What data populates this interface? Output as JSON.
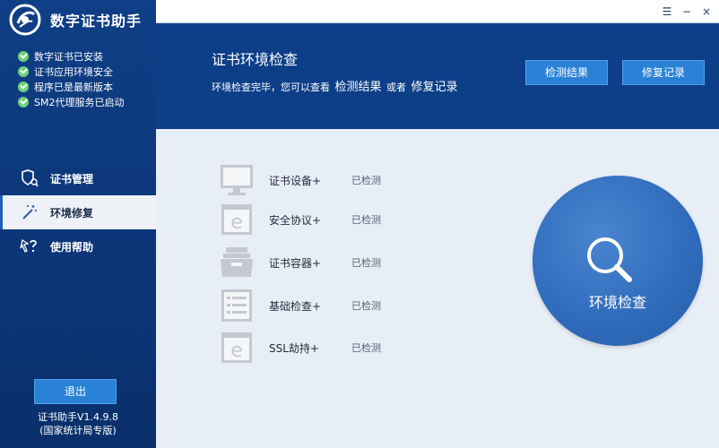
{
  "app": {
    "title": "数字证书助手"
  },
  "status_list": [
    "数字证书已安装",
    "证书应用环境安全",
    "程序已是最新版本",
    "SM2代理服务已启动"
  ],
  "nav": [
    {
      "label": "证书管理",
      "icon": "certificate-shield-icon",
      "active": false
    },
    {
      "label": "环境修复",
      "icon": "magic-wand-icon",
      "active": true
    },
    {
      "label": "使用帮助",
      "icon": "help-question-icon",
      "active": false
    }
  ],
  "footer": {
    "logout_label": "退出",
    "version_line1": "证书助手V1.4.9.8",
    "version_line2": "(国家统计局专版)"
  },
  "window_controls": {
    "menu": "☰",
    "minimize": "−",
    "close": "×"
  },
  "header": {
    "title": "证书环境检查",
    "subtitle_prefix": "环境检查完毕，您可以查看",
    "subtitle_link1": "检测结果",
    "subtitle_mid": "或者",
    "subtitle_link2": "修复记录",
    "btn_result": "检测结果",
    "btn_record": "修复记录"
  },
  "checks": [
    {
      "label": "证书设备+",
      "status": "已检测",
      "icon": "monitor-icon"
    },
    {
      "label": "安全协议+",
      "status": "已检测",
      "icon": "browser-e-icon"
    },
    {
      "label": "证书容器+",
      "status": "已检测",
      "icon": "container-box-icon"
    },
    {
      "label": "基础检查+",
      "status": "已检测",
      "icon": "checklist-icon"
    },
    {
      "label": "SSL劫持+",
      "status": "已检测",
      "icon": "browser-e-icon"
    }
  ],
  "big_button": {
    "label": "环境检查",
    "icon": "magnifier-icon"
  },
  "colors": {
    "sidebar": "#0c3577",
    "header": "#0d3f88",
    "button": "#2a82d6",
    "big_button": "#2f6bbb",
    "check_green": "#6fd27a",
    "main_bg": "#e8eef6"
  }
}
